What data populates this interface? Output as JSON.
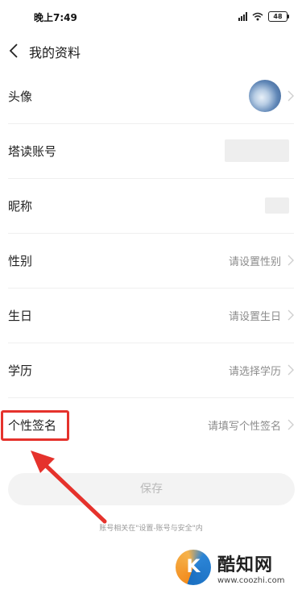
{
  "status_bar": {
    "time": "晚上7:49",
    "battery": "48"
  },
  "nav": {
    "title": "我的资料"
  },
  "rows": [
    {
      "label": "头像"
    },
    {
      "label": "塔读账号"
    },
    {
      "label": "昵称"
    },
    {
      "label": "性别",
      "value": "请设置性别"
    },
    {
      "label": "生日",
      "value": "请设置生日"
    },
    {
      "label": "学历",
      "value": "请选择学历"
    },
    {
      "label": "个性签名",
      "value": "请填写个性签名"
    }
  ],
  "save_label": "保存",
  "footer_note": "账号相关在\"设置-账号与安全\"内",
  "watermark": {
    "name": "酷知网",
    "url": "www.coozhi.com"
  },
  "colors": {
    "highlight": "#e5322c",
    "accent_blue": "#2b84d6",
    "accent_orange": "#f28c1e"
  }
}
